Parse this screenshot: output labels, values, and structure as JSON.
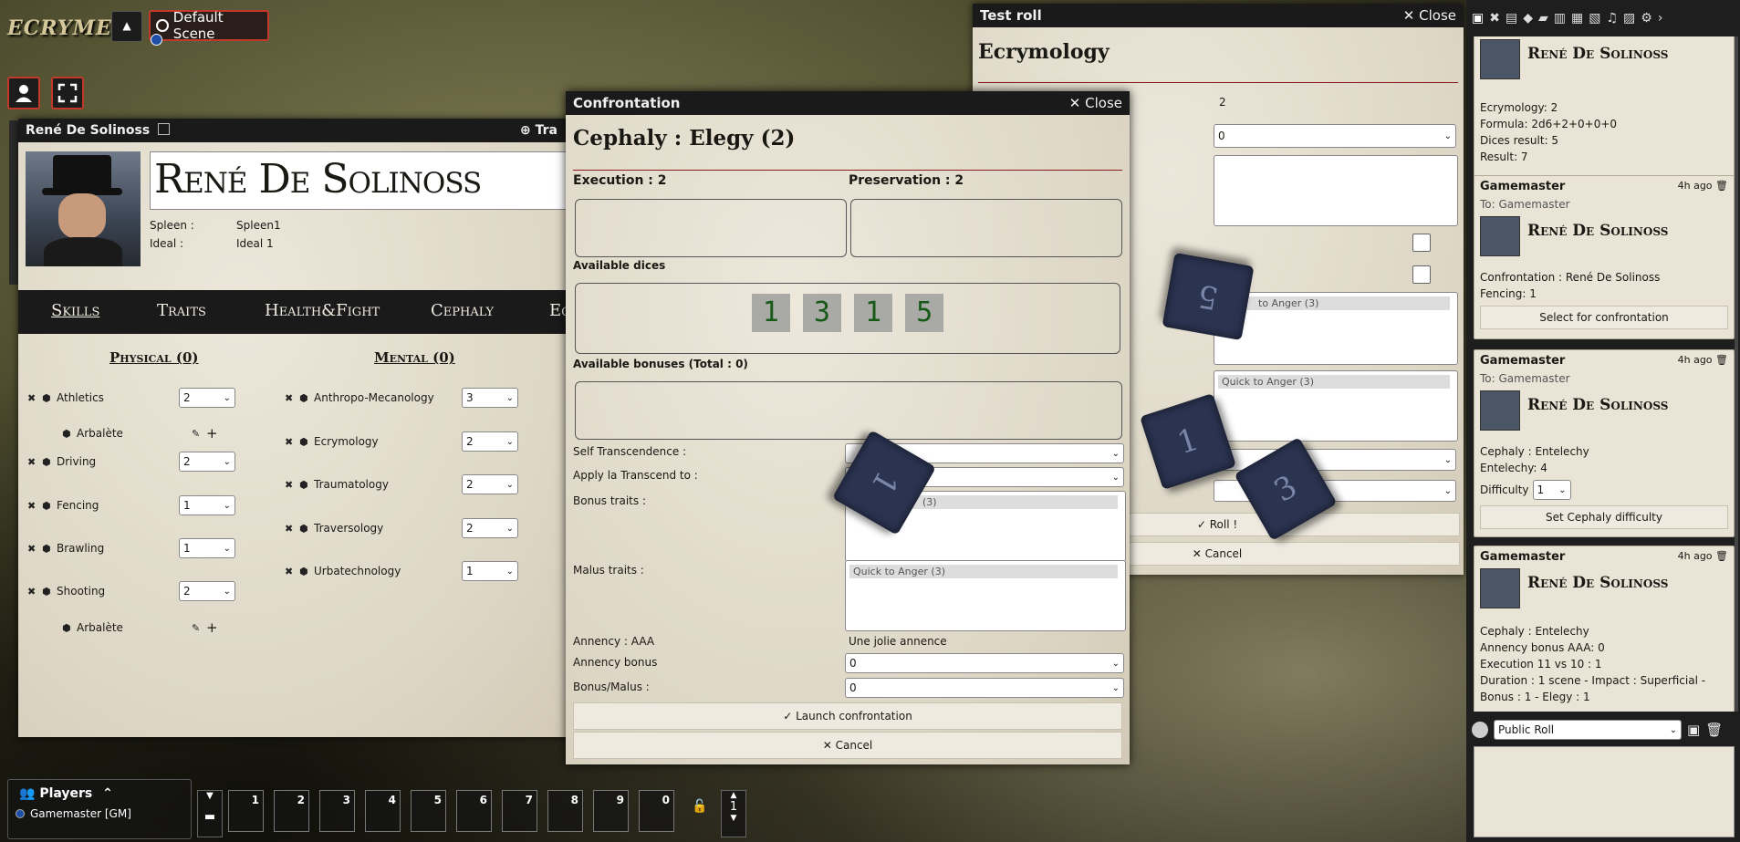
{
  "app": {
    "logo": "ECRYME"
  },
  "scene_button": {
    "label": "Default Scene"
  },
  "test_roll": {
    "title": "Test roll",
    "close": "Close",
    "heading": "Ecrymology",
    "value": "2",
    "select_value": "0",
    "trait_list_1": "to Anger (3)",
    "trait_list_2": "Quick to Anger (3)",
    "roll_label": "Roll !",
    "cancel_label": "Cancel"
  },
  "confrontation": {
    "title": "Confrontation",
    "close": "Close",
    "heading": "Cephaly : Elegy (2)",
    "execution": "Execution : 2",
    "preservation": "Preservation : 2",
    "available_dices_label": "Available dices",
    "dices": [
      "1",
      "3",
      "1",
      "5"
    ],
    "available_bonuses_label": "Available bonuses (Total : 0)",
    "self_transcendence_label": "Self Transcendence :",
    "apply_transcend_label": "Apply la Transcend to :",
    "bonus_traits_label": "Bonus traits :",
    "bonus_traits_item": "(3)",
    "malus_traits_label": "Malus traits :",
    "malus_traits_item": "Quick to Anger (3)",
    "annency_label": "Annency : AAA",
    "annency_value": "Une jolie annence",
    "annency_bonus_label": "Annency bonus",
    "annency_bonus_value": "0",
    "bonus_malus_label": "Bonus/Malus :",
    "bonus_malus_value": "0",
    "launch_label": "Launch confrontation",
    "cancel_label": "Cancel"
  },
  "sheet": {
    "window_title": "René De Solinoss",
    "translate_label": "Tra",
    "name": "René De Solinoss",
    "spleen_label": "Spleen :",
    "spleen_value": "Spleen1",
    "ideal_label": "Ideal :",
    "ideal_value": "Ideal 1",
    "tabs": [
      "Skills",
      "Traits",
      "Health&Fight",
      "Cephaly",
      "Ec"
    ],
    "physical_header": "Physical (0)",
    "mental_header": "Mental (0)",
    "physical_skills": [
      {
        "name": "Athletics",
        "value": "2"
      },
      {
        "name": "Arbalète"
      },
      {
        "name": "Driving",
        "value": "2"
      },
      {
        "name": "Fencing",
        "value": "1"
      },
      {
        "name": "Brawling",
        "value": "1"
      },
      {
        "name": "Shooting",
        "value": "2"
      },
      {
        "name": "Arbalète"
      }
    ],
    "mental_skills": [
      {
        "name": "Anthropo-Mecanology",
        "value": "3"
      },
      {
        "name": "Ecrymology",
        "value": "2"
      },
      {
        "name": "Traumatology",
        "value": "2"
      },
      {
        "name": "Traversology",
        "value": "2"
      },
      {
        "name": "Urbatechnology",
        "value": "1"
      }
    ]
  },
  "players": {
    "title": "Players",
    "entry": "Gamemaster [GM]"
  },
  "hotbar": {
    "slots": [
      "1",
      "2",
      "3",
      "4",
      "5",
      "6",
      "7",
      "8",
      "9",
      "0"
    ],
    "page": "1"
  },
  "dice_3d": [
    "5",
    "1",
    "1",
    "3"
  ],
  "chat": {
    "card0": {
      "name": "René De Solinoss",
      "lines": [
        "Ecrymology: 2",
        "Formula: 2d6+2+0+0+0",
        "Dices result: 5",
        "Result: 7"
      ]
    },
    "card1": {
      "sender": "Gamemaster",
      "time": "4h ago",
      "to": "To: Gamemaster",
      "name": "René De Solinoss",
      "lines": [
        "Confrontation : René De Solinoss",
        "Fencing: 1"
      ],
      "button": "Select for confrontation"
    },
    "card2": {
      "sender": "Gamemaster",
      "time": "4h ago",
      "to": "To: Gamemaster",
      "name": "René De Solinoss",
      "lines": [
        "Cephaly : Entelechy",
        "Entelechy: 4"
      ],
      "difficulty_label": "Difficulty",
      "difficulty_value": "1",
      "button": "Set Cephaly difficulty"
    },
    "card3": {
      "sender": "Gamemaster",
      "time": "4h ago",
      "name": "René De Solinoss",
      "lines": [
        "Cephaly : Entelechy",
        "Annency bonus AAA: 0",
        "Execution 11 vs 10 : 1",
        "Duration : 1 scene - Impact : Superficial -",
        "Bonus : 1 - Elegy : 1"
      ]
    },
    "roll_mode": "Public Roll"
  }
}
